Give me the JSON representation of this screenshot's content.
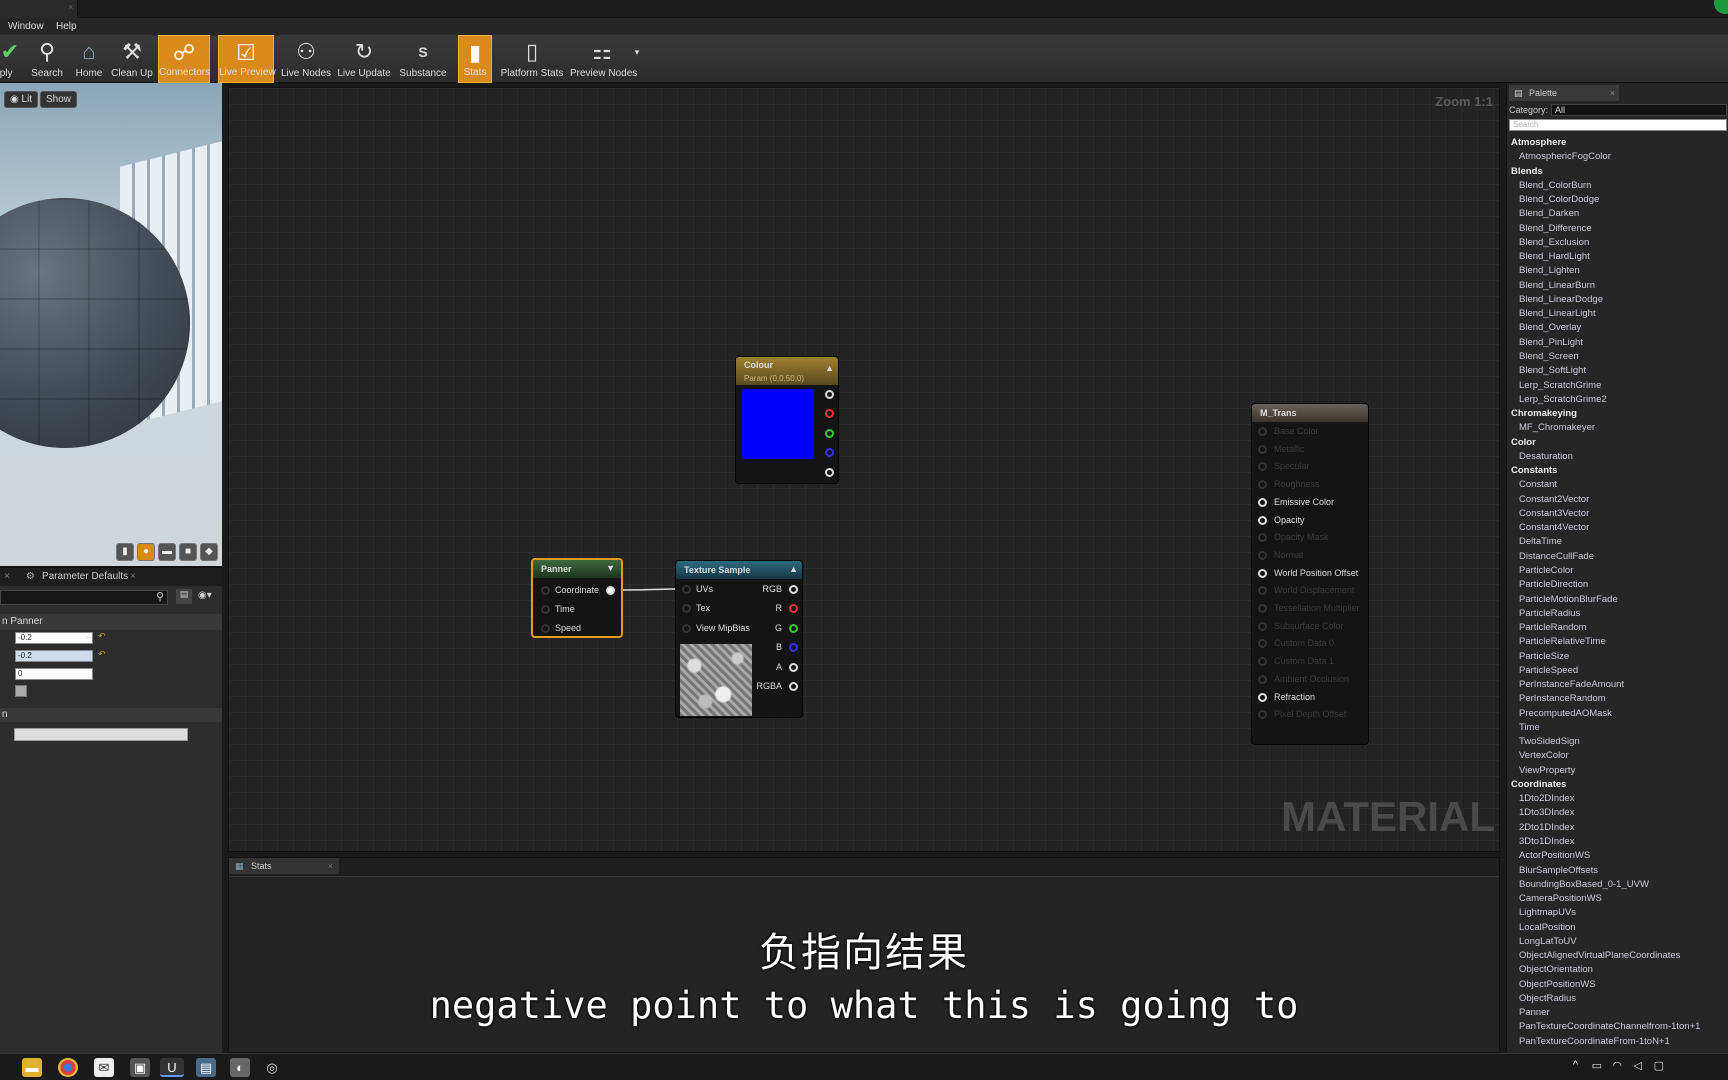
{
  "menu": {
    "window": "Window",
    "help": "Help"
  },
  "toolbar": {
    "items": [
      {
        "label": "Apply",
        "icon": "check-icon"
      },
      {
        "label": "Search",
        "icon": "binoculars-icon"
      },
      {
        "label": "Home",
        "icon": "home-icon"
      },
      {
        "label": "Clean Up",
        "icon": "broom-icon"
      },
      {
        "label": "Connectors",
        "icon": "connectors-icon",
        "active": true
      },
      {
        "label": "Live Preview",
        "icon": "live-preview-icon",
        "active": true
      },
      {
        "label": "Live Nodes",
        "icon": "live-nodes-icon"
      },
      {
        "label": "Live Update",
        "icon": "live-update-icon"
      },
      {
        "label": "Substance",
        "icon": "substance-icon"
      },
      {
        "label": "Stats",
        "icon": "stats-icon",
        "active": true
      },
      {
        "label": "Platform Stats",
        "icon": "platform-stats-icon"
      },
      {
        "label": "Preview Nodes",
        "icon": "preview-nodes-icon"
      }
    ]
  },
  "viewport": {
    "lit": "Lit",
    "show": "Show"
  },
  "details": {
    "tab": "Parameter Defaults",
    "section": "n Panner",
    "v1": "-0.2",
    "v2": "-0.2",
    "v3": "0",
    "section2": "n"
  },
  "graph": {
    "zoom": "Zoom 1:1",
    "watermark": "MATERIAL"
  },
  "nodes": {
    "colour": {
      "title": "Colour",
      "subtitle": "Param (0,0,50,0)",
      "color": "#0000ff"
    },
    "panner": {
      "title": "Panner",
      "inputs": [
        "Coordinate",
        "Time",
        "Speed"
      ]
    },
    "texture": {
      "title": "Texture Sample",
      "inputs": [
        "UVs",
        "Tex",
        "View MipBias"
      ],
      "outputs": [
        "RGB",
        "R",
        "G",
        "B",
        "A",
        "RGBA"
      ]
    },
    "mtrans": {
      "title": "M_Trans",
      "pins": [
        {
          "label": "Base Color",
          "active": false
        },
        {
          "label": "Metallic",
          "active": false
        },
        {
          "label": "Specular",
          "active": false
        },
        {
          "label": "Roughness",
          "active": false
        },
        {
          "label": "Emissive Color",
          "active": true
        },
        {
          "label": "Opacity",
          "active": true
        },
        {
          "label": "Opacity Mask",
          "active": false
        },
        {
          "label": "Normal",
          "active": false
        },
        {
          "label": "World Position Offset",
          "active": true
        },
        {
          "label": "World Displacement",
          "active": false
        },
        {
          "label": "Tessellation Multiplier",
          "active": false
        },
        {
          "label": "Subsurface Color",
          "active": false
        },
        {
          "label": "Custom Data 0",
          "active": false
        },
        {
          "label": "Custom Data 1",
          "active": false
        },
        {
          "label": "Ambient Occlusion",
          "active": false
        },
        {
          "label": "Refraction",
          "active": true
        },
        {
          "label": "Pixel Depth Offset",
          "active": false
        }
      ]
    }
  },
  "palette": {
    "tab": "Palette",
    "category_label": "Category:",
    "category_value": "All",
    "search_placeholder": "Search",
    "items": [
      {
        "h": "Atmosphere"
      },
      {
        "i": "AtmosphericFogColor"
      },
      {
        "h": "Blends"
      },
      {
        "i": "Blend_ColorBurn"
      },
      {
        "i": "Blend_ColorDodge"
      },
      {
        "i": "Blend_Darken"
      },
      {
        "i": "Blend_Difference"
      },
      {
        "i": "Blend_Exclusion"
      },
      {
        "i": "Blend_HardLight"
      },
      {
        "i": "Blend_Lighten"
      },
      {
        "i": "Blend_LinearBurn"
      },
      {
        "i": "Blend_LinearDodge"
      },
      {
        "i": "Blend_LinearLight"
      },
      {
        "i": "Blend_Overlay"
      },
      {
        "i": "Blend_PinLight"
      },
      {
        "i": "Blend_Screen"
      },
      {
        "i": "Blend_SoftLight"
      },
      {
        "i": "Lerp_ScratchGrime"
      },
      {
        "i": "Lerp_ScratchGrime2"
      },
      {
        "h": "Chromakeying"
      },
      {
        "i": "MF_Chromakeyer"
      },
      {
        "h": "Color"
      },
      {
        "i": "Desaturation"
      },
      {
        "h": "Constants"
      },
      {
        "i": "Constant"
      },
      {
        "i": "Constant2Vector"
      },
      {
        "i": "Constant3Vector"
      },
      {
        "i": "Constant4Vector"
      },
      {
        "i": "DeltaTime"
      },
      {
        "i": "DistanceCullFade"
      },
      {
        "i": "ParticleColor"
      },
      {
        "i": "ParticleDirection"
      },
      {
        "i": "ParticleMotionBlurFade"
      },
      {
        "i": "ParticleRadius"
      },
      {
        "i": "ParticleRandom"
      },
      {
        "i": "ParticleRelativeTime"
      },
      {
        "i": "ParticleSize"
      },
      {
        "i": "ParticleSpeed"
      },
      {
        "i": "PerInstanceFadeAmount"
      },
      {
        "i": "PerInstanceRandom"
      },
      {
        "i": "PrecomputedAOMask"
      },
      {
        "i": "Time"
      },
      {
        "i": "TwoSidedSign"
      },
      {
        "i": "VertexColor"
      },
      {
        "i": "ViewProperty"
      },
      {
        "h": "Coordinates"
      },
      {
        "i": "1Dto2DIndex"
      },
      {
        "i": "1Dto3DIndex"
      },
      {
        "i": "2Dto1DIndex"
      },
      {
        "i": "3Dto1DIndex"
      },
      {
        "i": "ActorPositionWS"
      },
      {
        "i": "BlurSampleOffsets"
      },
      {
        "i": "BoundingBoxBased_0-1_UVW"
      },
      {
        "i": "CameraPositionWS"
      },
      {
        "i": "LightmapUVs"
      },
      {
        "i": "LocalPosition"
      },
      {
        "i": "LongLatToUV"
      },
      {
        "i": "ObjectAlignedVirtualPlaneCoordinates"
      },
      {
        "i": "ObjectOrientation"
      },
      {
        "i": "ObjectPositionWS"
      },
      {
        "i": "ObjectRadius"
      },
      {
        "i": "Panner"
      },
      {
        "i": "PanTextureCoordinateChannelfrom-1ton+1"
      },
      {
        "i": "PanTextureCoordinateFrom-1toN+1"
      }
    ]
  },
  "stats": {
    "tab": "Stats"
  },
  "subtitles": {
    "cn": "负指向结果",
    "en": "negative point to what this is going to"
  }
}
